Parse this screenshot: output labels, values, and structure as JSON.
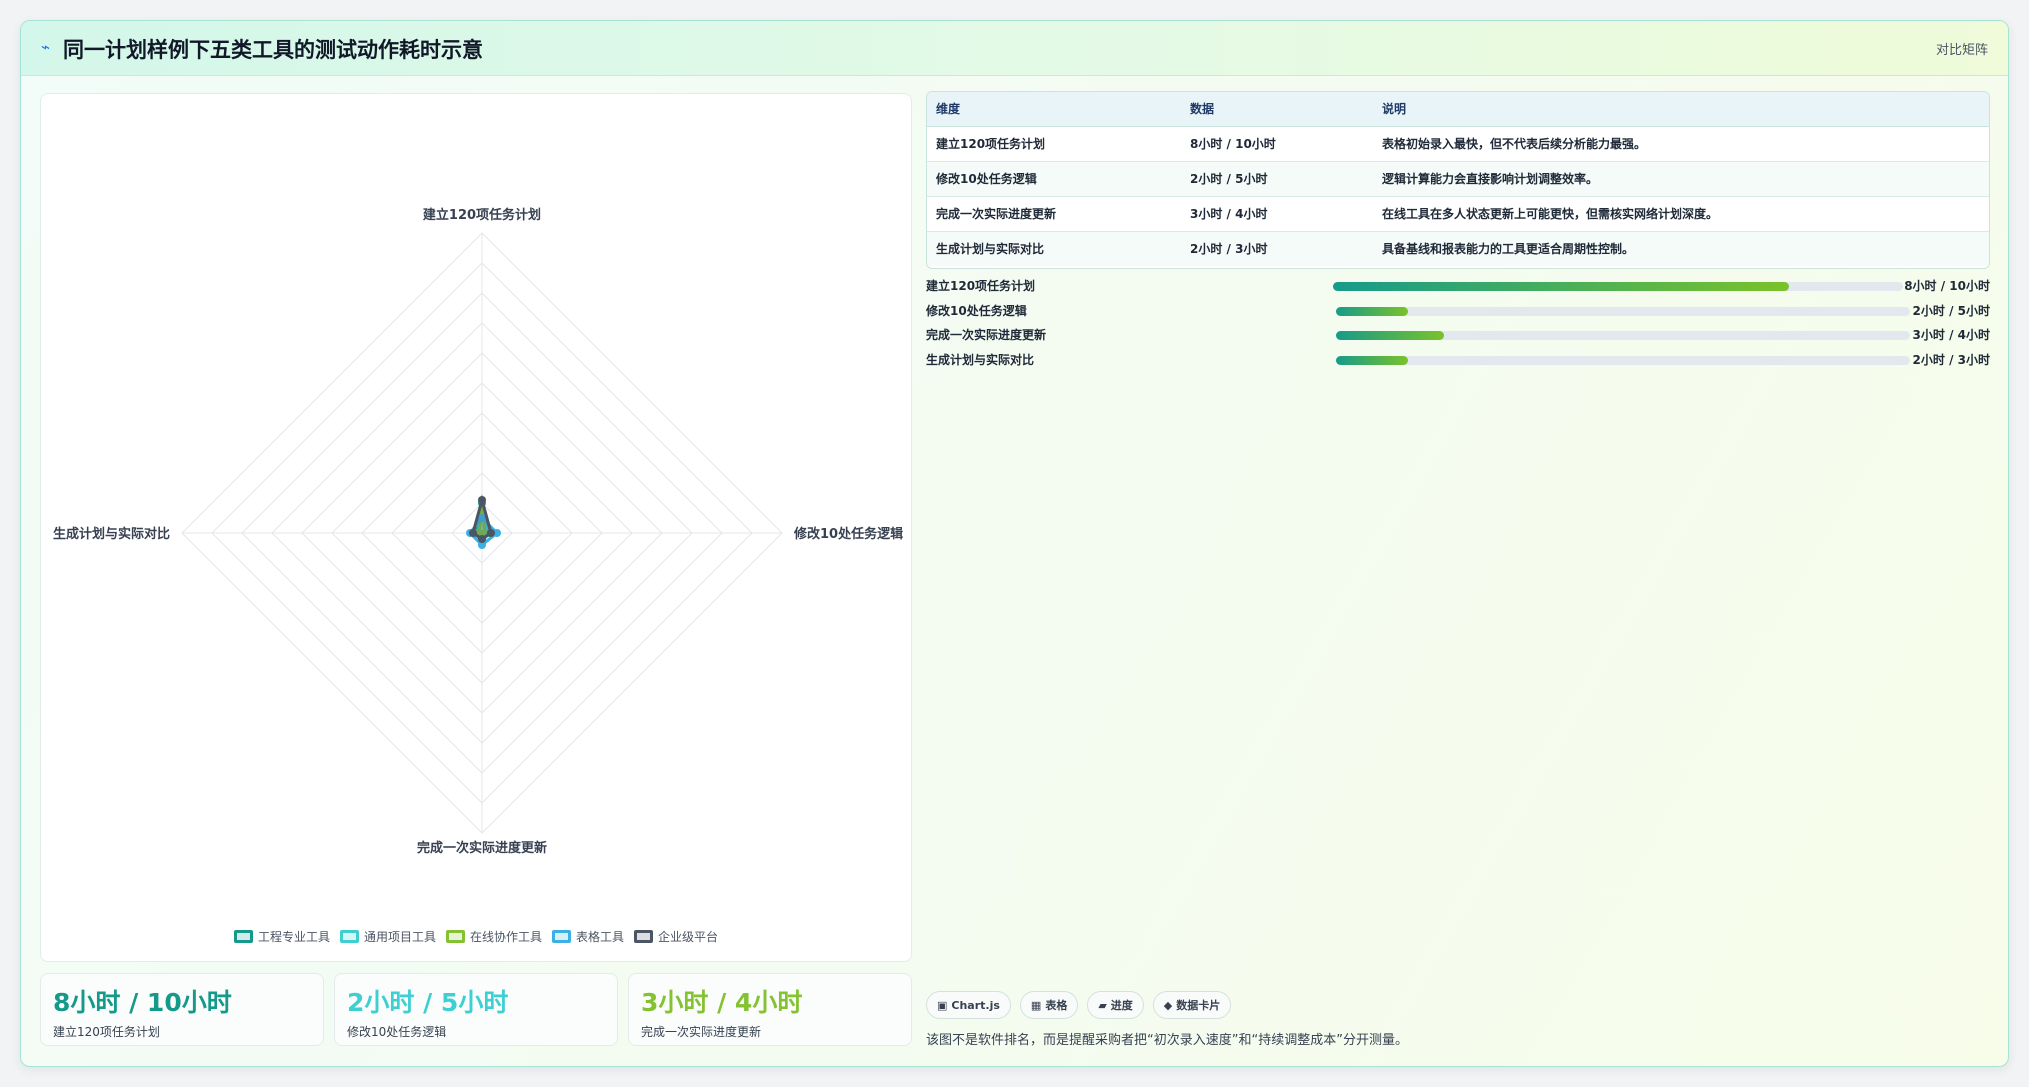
{
  "header": {
    "title": "同一计划样例下五类工具的测试动作耗时示意",
    "tag": "对比矩阵",
    "icon": "chart-icon"
  },
  "chart_data": {
    "type": "radar",
    "axes": [
      "建立120项任务计划",
      "修改10处任务逻辑",
      "完成一次实际进度更新",
      "生成计划与实际对比"
    ],
    "series": [
      {
        "name": "工程专业工具",
        "color": "#14998a",
        "values": [
          1.0,
          0.25,
          0.25,
          0.25
        ]
      },
      {
        "name": "通用项目工具",
        "color": "#3ecfd2",
        "values": [
          0.65,
          0.2,
          0.3,
          0.15
        ]
      },
      {
        "name": "在线协作工具",
        "color": "#84c232",
        "values": [
          0.75,
          0.1,
          0.1,
          0.1
        ]
      },
      {
        "name": "表格工具",
        "color": "#3bb0e4",
        "values": [
          0.5,
          0.5,
          0.4,
          0.4
        ]
      },
      {
        "name": "企业级平台",
        "color": "#4b5563",
        "values": [
          1.1,
          0.3,
          0.2,
          0.3
        ]
      }
    ],
    "r_range": [
      0,
      10
    ],
    "grid": true,
    "legend_position": "bottom"
  },
  "table": {
    "headers": [
      "维度",
      "数据",
      "说明"
    ],
    "rows": [
      [
        "建立120项任务计划",
        "8小时 / 10小时",
        "表格初始录入最快，但不代表后续分析能力最强。"
      ],
      [
        "修改10处任务逻辑",
        "2小时 / 5小时",
        "逻辑计算能力会直接影响计划调整效率。"
      ],
      [
        "完成一次实际进度更新",
        "3小时 / 4小时",
        "在线工具在多人状态更新上可能更快，但需核实网络计划深度。"
      ],
      [
        "生成计划与实际对比",
        "2小时 / 3小时",
        "具备基线和报表能力的工具更适合周期性控制。"
      ]
    ]
  },
  "bars": [
    {
      "label": "建立120项任务计划",
      "value": "8小时 / 10小时",
      "fraction": 0.8
    },
    {
      "label": "修改10处任务逻辑",
      "value": "2小时 / 5小时",
      "fraction": 0.125
    },
    {
      "label": "完成一次实际进度更新",
      "value": "3小时 / 4小时",
      "fraction": 0.188
    },
    {
      "label": "生成计划与实际对比",
      "value": "2小时 / 3小时",
      "fraction": 0.125
    }
  ],
  "stats": [
    {
      "value": "8小时 / 10小时",
      "label": "建立120项任务计划",
      "color": "#14998a"
    },
    {
      "value": "2小时 / 5小时",
      "label": "修改10处任务逻辑",
      "color": "#3ecfd2"
    },
    {
      "value": "3小时 / 4小时",
      "label": "完成一次实际进度更新",
      "color": "#84c232"
    }
  ],
  "chips": [
    {
      "icon": "▣",
      "label": "Chart.js"
    },
    {
      "icon": "▦",
      "label": "表格"
    },
    {
      "icon": "▰",
      "label": "进度"
    },
    {
      "icon": "◆",
      "label": "数据卡片"
    }
  ],
  "note": "该图不是软件排名，而是提醒采购者把“初次录入速度”和“持续调整成本”分开测量。"
}
